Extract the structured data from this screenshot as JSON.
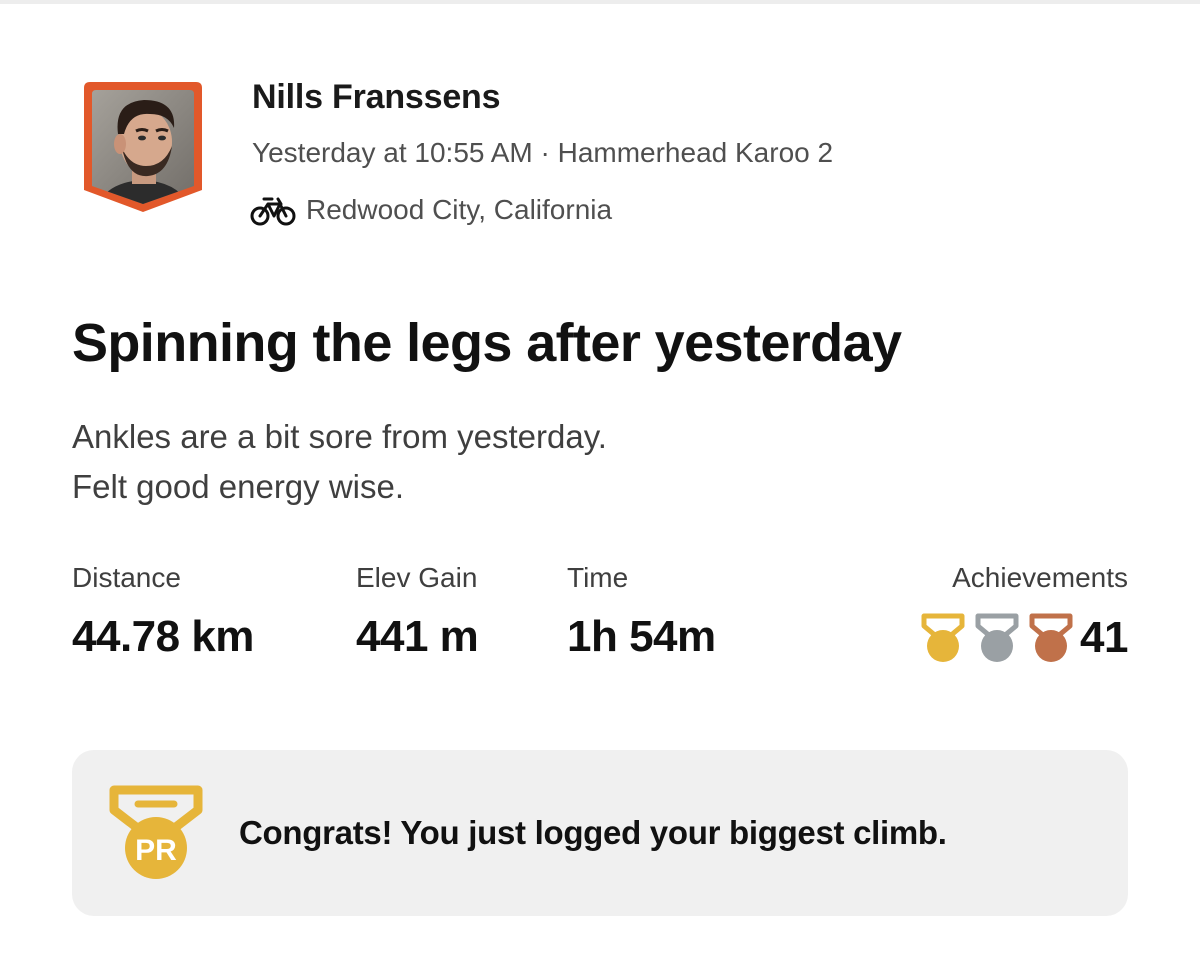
{
  "athlete": {
    "name": "Nills Franssens",
    "meta": "Yesterday at 10:55 AM · Hammerhead Karoo 2",
    "location": "Redwood City, California",
    "activity_icon": "bike-icon",
    "avatar_frame_color": "#e2582a"
  },
  "activity": {
    "title": "Spinning the legs after yesterday",
    "description_lines": [
      "Ankles are a bit sore from yesterday.",
      "Felt good energy wise."
    ]
  },
  "stats": {
    "distance": {
      "label": "Distance",
      "value": "44.78 km"
    },
    "elev_gain": {
      "label": "Elev Gain",
      "value": "441 m"
    },
    "time": {
      "label": "Time",
      "value": "1h 54m"
    },
    "achievements": {
      "label": "Achievements",
      "count": "41",
      "medals": [
        {
          "icon": "gold-medal-icon",
          "color": "#e6b53a"
        },
        {
          "icon": "silver-medal-icon",
          "color": "#9aa0a4"
        },
        {
          "icon": "bronze-medal-icon",
          "color": "#c0714a"
        }
      ]
    }
  },
  "pr_card": {
    "badge_text": "PR",
    "badge_color": "#e6b53a",
    "message": "Congrats! You just logged your biggest climb."
  }
}
